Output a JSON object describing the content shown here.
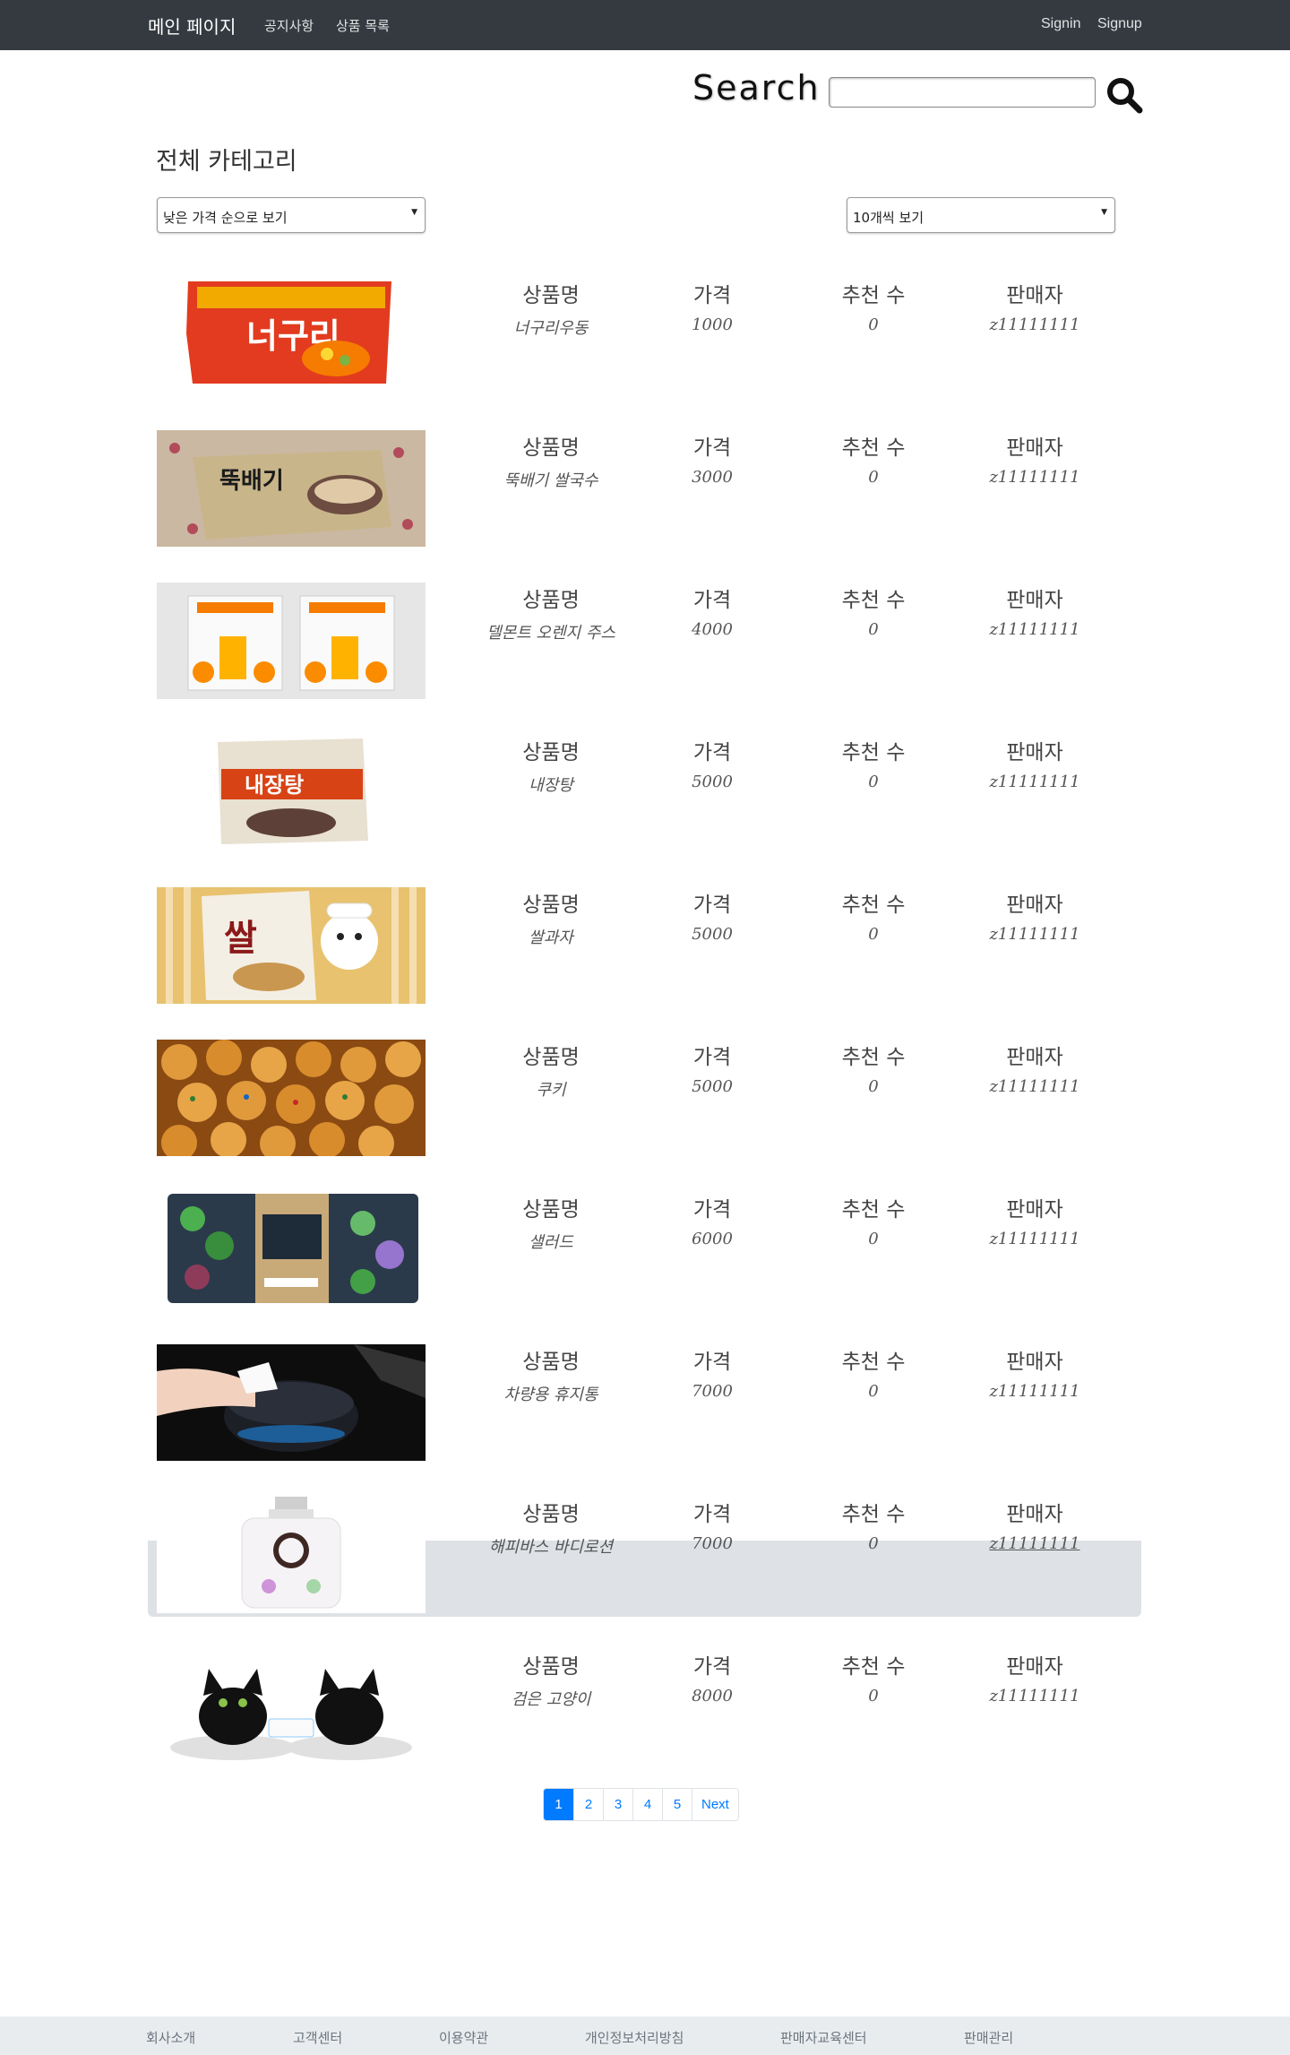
{
  "navbar": {
    "brand": "메인 페이지",
    "links": [
      "공지사항",
      "상품 목록"
    ],
    "signin": "Signin",
    "signup": "Signup"
  },
  "search": {
    "label": "Search",
    "value": "",
    "icon": "search-icon"
  },
  "category_title": "전체 카테고리",
  "sort_select": {
    "selected": "낮은 가격 순으로 보기"
  },
  "count_select": {
    "selected": "10개씩 보기"
  },
  "columns": {
    "name": "상품명",
    "price": "가격",
    "recommend": "추천 수",
    "seller": "판매자"
  },
  "products": [
    {
      "name": "너구리우동",
      "price": "1000",
      "recommend": "0",
      "seller": "z11111111",
      "image": "instant-noodle-image"
    },
    {
      "name": "뚝배기 쌀국수",
      "price": "3000",
      "recommend": "0",
      "seller": "z11111111",
      "image": "rice-noodle-image"
    },
    {
      "name": "델몬트 오렌지 주스",
      "price": "4000",
      "recommend": "0",
      "seller": "z11111111",
      "image": "orange-juice-image"
    },
    {
      "name": "내장탕",
      "price": "5000",
      "recommend": "0",
      "seller": "z11111111",
      "image": "soup-pack-image"
    },
    {
      "name": "쌀과자",
      "price": "5000",
      "recommend": "0",
      "seller": "z11111111",
      "image": "rice-cracker-image"
    },
    {
      "name": "쿠키",
      "price": "5000",
      "recommend": "0",
      "seller": "z11111111",
      "image": "cookie-image"
    },
    {
      "name": "샐러드",
      "price": "6000",
      "recommend": "0",
      "seller": "z11111111",
      "image": "salad-image"
    },
    {
      "name": "차량용 휴지통",
      "price": "7000",
      "recommend": "0",
      "seller": "z11111111",
      "image": "car-trash-bin-image"
    },
    {
      "name": "해피바스 바디로션",
      "price": "7000",
      "recommend": "0",
      "seller": "z11111111",
      "image": "body-lotion-image"
    },
    {
      "name": "검은 고양이",
      "price": "8000",
      "recommend": "0",
      "seller": "z11111111",
      "image": "black-cat-figure-image"
    }
  ],
  "pagination": {
    "pages": [
      "1",
      "2",
      "3",
      "4",
      "5"
    ],
    "next": "Next",
    "active": "1"
  },
  "footer": {
    "links": [
      "회사소개",
      "고객센터",
      "이용약관",
      "개인정보처리방침",
      "판매자교육센터",
      "판매관리"
    ]
  },
  "colors": {
    "navbar": "#343a40",
    "accent": "#007bff",
    "hover_row": "#dee2e6",
    "footer": "#e9ecef"
  }
}
